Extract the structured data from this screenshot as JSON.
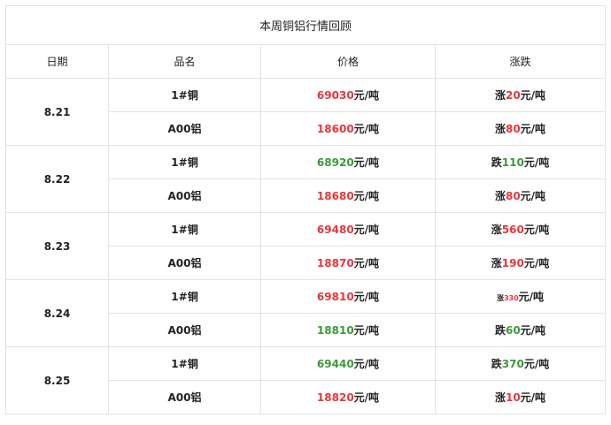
{
  "title": "本周铜铝行情回顾",
  "headers": [
    "日期",
    "品名",
    "价格",
    "涨跌"
  ],
  "unit": "元/吨",
  "colors": {
    "up": "#e8363c",
    "down": "#3a9a3a"
  },
  "days": [
    {
      "date": "8.21",
      "rows": [
        {
          "name": "1#铜",
          "price": "69030",
          "price_dir": "up",
          "chg_word": "涨",
          "chg": "20",
          "chg_dir": "up"
        },
        {
          "name": "A00铝",
          "price": "18600",
          "price_dir": "up",
          "chg_word": "涨",
          "chg": "80",
          "chg_dir": "up"
        }
      ]
    },
    {
      "date": "8.22",
      "rows": [
        {
          "name": "1#铜",
          "price": "68920",
          "price_dir": "down",
          "chg_word": "跌",
          "chg": "110",
          "chg_dir": "down"
        },
        {
          "name": "A00铝",
          "price": "18680",
          "price_dir": "up",
          "chg_word": "涨",
          "chg": "80",
          "chg_dir": "up"
        }
      ]
    },
    {
      "date": "8.23",
      "rows": [
        {
          "name": "1#铜",
          "price": "69480",
          "price_dir": "up",
          "chg_word": "涨",
          "chg": "560",
          "chg_dir": "up"
        },
        {
          "name": "A00铝",
          "price": "18870",
          "price_dir": "up",
          "chg_word": "涨",
          "chg": "190",
          "chg_dir": "up"
        }
      ]
    },
    {
      "date": "8.24",
      "rows": [
        {
          "name": "1#铜",
          "price": "69810",
          "price_dir": "up",
          "chg_word": "涨",
          "chg": "330",
          "chg_dir": "up",
          "small": true
        },
        {
          "name": "A00铝",
          "price": "18810",
          "price_dir": "down",
          "chg_word": "跌",
          "chg": "60",
          "chg_dir": "down"
        }
      ]
    },
    {
      "date": "8.25",
      "rows": [
        {
          "name": "1#铜",
          "price": "69440",
          "price_dir": "down",
          "chg_word": "跌",
          "chg": "370",
          "chg_dir": "down"
        },
        {
          "name": "A00铝",
          "price": "18820",
          "price_dir": "up",
          "chg_word": "涨",
          "chg": "10",
          "chg_dir": "up"
        }
      ]
    }
  ]
}
